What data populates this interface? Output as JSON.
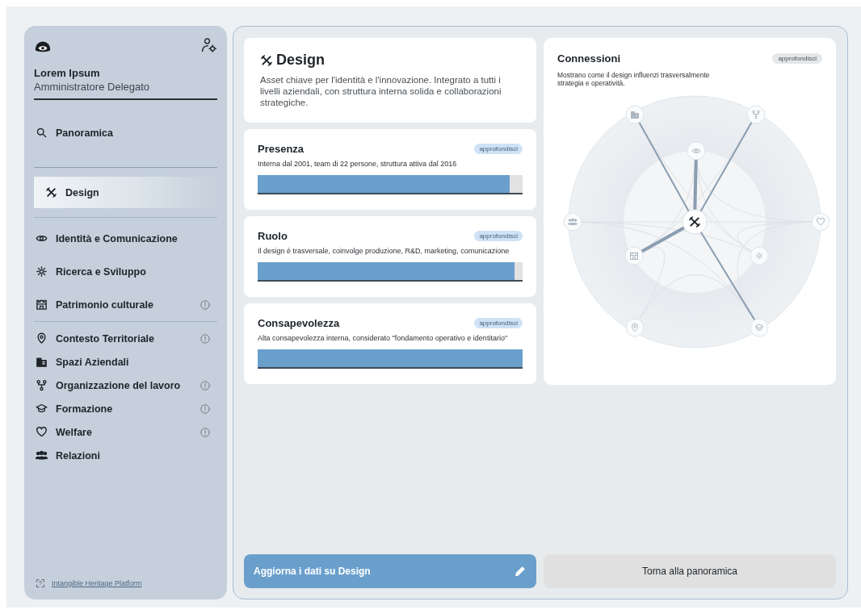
{
  "sidebar": {
    "user": {
      "name": "Lorem Ipsum",
      "role": "Amministratore Delegato"
    },
    "groups": [
      {
        "items": [
          {
            "label": "Panoramica",
            "selected": false,
            "alert": false
          }
        ]
      },
      {
        "items": [
          {
            "label": "Design",
            "selected": true,
            "alert": false
          }
        ]
      },
      {
        "items": [
          {
            "label": "Identità e Comunicazione",
            "selected": false,
            "alert": false
          },
          {
            "label": "Ricerca e Sviluppo",
            "selected": false,
            "alert": false
          },
          {
            "label": "Patrimonio culturale",
            "selected": false,
            "alert": true
          }
        ]
      },
      {
        "items": [
          {
            "label": "Contesto Territoriale",
            "selected": false,
            "alert": true
          },
          {
            "label": "Spazi Aziendali",
            "selected": false,
            "alert": false
          },
          {
            "label": "Organizzazione del lavoro",
            "selected": false,
            "alert": true
          },
          {
            "label": "Formazione",
            "selected": false,
            "alert": true
          },
          {
            "label": "Welfare",
            "selected": false,
            "alert": true
          },
          {
            "label": "Relazioni",
            "selected": false,
            "alert": false
          }
        ]
      }
    ],
    "footer_link": "Intangible Heritage Platform"
  },
  "summary": {
    "title": "Design",
    "description": "Asset chiave per l'identità e l'innovazione. Integrato a tutti i livelli aziendali, con struttura interna solida e collaborazioni strategiche."
  },
  "metrics": [
    {
      "title": "Presenza",
      "link": "approfondisci",
      "description": "Interna dal 2001, team di 22 persone, struttura attiva dal 2016",
      "level": 0.95
    },
    {
      "title": "Ruolo",
      "link": "approfondisci",
      "description": "Il design è trasversale, coinvolge produzione, R&D, marketing, comunicazione",
      "level": 0.97
    },
    {
      "title": "Consapevolezza",
      "link": "approfondisci",
      "description": "Alta consapevolezza interna, considerato \"fondamento operativo e identitario\"",
      "level": 1.0
    }
  ],
  "connections": {
    "title": "Connessioni",
    "link": "approfondisci",
    "description": "Mostrano come il design influenzi trasversalmente strategia e operatività."
  },
  "actions": [
    {
      "label": "Aggiorna i dati su Design",
      "kind": "primary"
    },
    {
      "label": "Torna alla panoramica",
      "kind": "secondary"
    }
  ]
}
